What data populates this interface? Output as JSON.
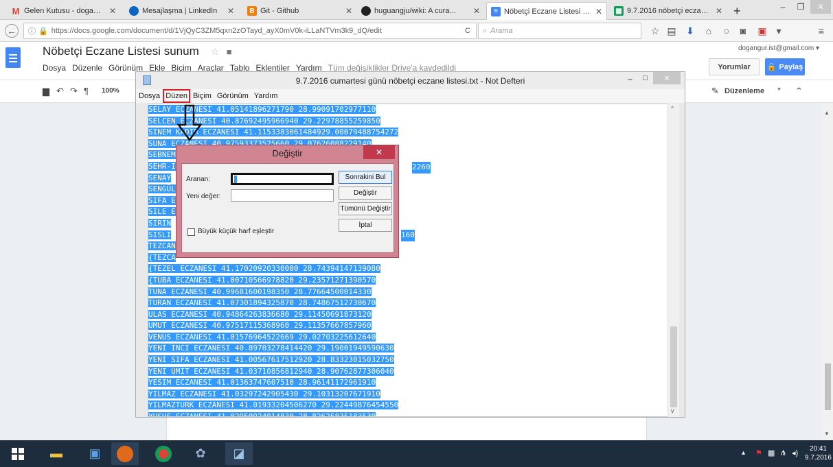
{
  "browser": {
    "tabs": [
      {
        "label": "Gelen Kutusu - dogang...",
        "icon": "gmail-icon",
        "color": "#d44638"
      },
      {
        "label": "Mesajlaşma | LinkedIn",
        "icon": "linkedin-icon",
        "color": "#0a66c2"
      },
      {
        "label": "Git - Github",
        "icon": "blogger-icon",
        "color": "#f57d00"
      },
      {
        "label": "huguangju/wiki: A cura...",
        "icon": "github-icon",
        "color": "#222222"
      },
      {
        "label": "Nöbetçi Eczane Listesi s...",
        "icon": "docs-icon",
        "color": "#4285f4"
      },
      {
        "label": "9.7.2016 nöbetçi eczane...",
        "icon": "sheets-icon",
        "color": "#0f9d58"
      }
    ],
    "url": "https://docs.google.com/document/d/1VjQyC3ZM5qxn2zOTayd_ayX0mV0k-iLLaNTVm3k9_dQ/edit",
    "search_placeholder": "Arama"
  },
  "docs": {
    "title": "Nöbetçi Eczane Listesi sunum",
    "menu": [
      "Dosya",
      "Düzenle",
      "Görünüm",
      "Ekle",
      "Biçim",
      "Araçlar",
      "Tablo",
      "Eklentiler",
      "Yardım"
    ],
    "saved_status": "Tüm değişiklikler Drive'a kaydedildi",
    "email": "dogangur.ist@gmail.com",
    "comments_label": "Yorumlar",
    "share_label": "Paylaş",
    "zoom": "100%",
    "mode_label": "Düzenleme"
  },
  "notepad": {
    "title": "9.7.2016 cumartesi günü nöbetçi eczane listesi.txt - Not Defteri",
    "menu": [
      "Dosya",
      "Düzen",
      "Biçim",
      "Görünüm",
      "Yardım"
    ],
    "lines": [
      "SELAY ECZANESI 41.05141896271790 28.99091702977110",
      "SELCEN ECZANESI 40.87692495966940 29.22978855259850",
      "SINEM KADIR ECZANESI 41.1153383061484929.00079488754272",
      "SUNA ECZANESI 40.97593373525660 29.07626088229140",
      "SEBNEM",
      "SEHR-I",
      "SENAY",
      "SENGÜL",
      "SIFA E",
      "SILE E",
      "SIRIN",
      "SISLI",
      "TEZCAN",
      "{TEZCA",
      "{TEZEL ECZANESI 41.17020920330000 28.74394147139080",
      "{TUBA ECZANESI 41.00710566978820 29.23571271390570",
      "TUNA ECZANESI 40.99681600198350 28.77664500014330",
      "TURAN ECZANESI 41.07301894325870 28.74867512730670",
      "ULAS ECZANESI 40.94864263836680 29.11450691873120",
      "UMUT ECZANESI 40.97517115368960 29.11357667857960",
      "VENUS ECZANESI 41.01576964522669 29.02703225612640",
      "YENI INCI ECZANESI 40.89703278414420 29.19001949590630",
      "YENI SIFA ECZANESI 41.00567617512920 28.83323015032750",
      "YENI UMIT ECZANESI 41.03710856812940 28.90762877306040",
      "YESIM ECZANESI 41.01363747607510 28.96141172961910",
      "YILMAZ ECZANESI 41.03297242905430 29.10313207671910",
      "YILMAZTURK ECZANESI 41.01933204506270 29.22449876454550",
      "YUSUF ECZANESI 41.02950924014830 28.82625835183530"
    ],
    "partial_tails": [
      "2260",
      "160"
    ]
  },
  "replace_dialog": {
    "title": "Değiştir",
    "find_label": "Aranan:",
    "replace_label": "Yeni değer:",
    "find_next": "Sonrakini Bul",
    "replace": "Değiştir",
    "replace_all": "Tümünü Değiştir",
    "cancel": "İptal",
    "match_case": "Büyük küçük harf eşleştir",
    "find_value": "",
    "replace_value": ""
  },
  "taskbar": {
    "time": "20:41",
    "date": "9.7.2016"
  },
  "annotation_color": "#e02020"
}
